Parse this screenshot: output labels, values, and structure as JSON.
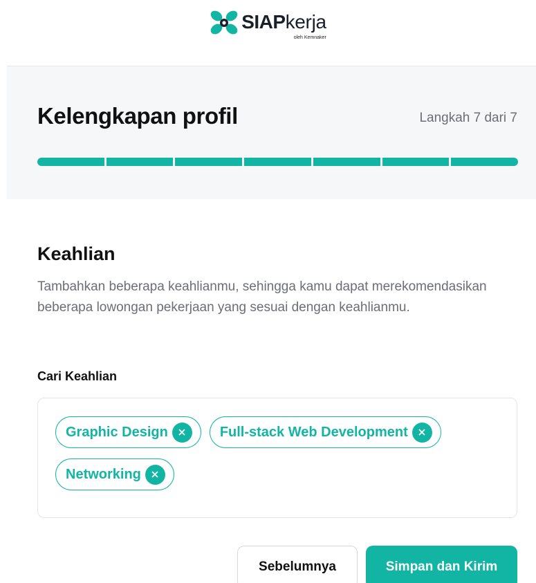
{
  "brand": {
    "name_bold": "SIAP",
    "name_regular": "kerja",
    "tagline": "oleh Kemnaker",
    "color": "#12b5a3"
  },
  "header": {
    "title": "Kelengkapan profil",
    "step_label": "Langkah 7 dari 7",
    "progress": {
      "current_step": 7,
      "total_steps": 7
    }
  },
  "section": {
    "title": "Keahlian",
    "description": "Tambahkan beberapa keahlianmu, sehingga kamu dapat merekomendasikan beberapa lowongan pekerjaan yang sesuai dengan keahlianmu."
  },
  "skills": {
    "label": "Cari Keahlian",
    "chips": [
      {
        "label": "Graphic Design",
        "remove_icon": "close-icon"
      },
      {
        "label": "Full-stack Web Development",
        "remove_icon": "close-icon"
      },
      {
        "label": "Networking",
        "remove_icon": "close-icon"
      }
    ]
  },
  "actions": {
    "prev_label": "Sebelumnya",
    "submit_label": "Simpan dan Kirim"
  }
}
